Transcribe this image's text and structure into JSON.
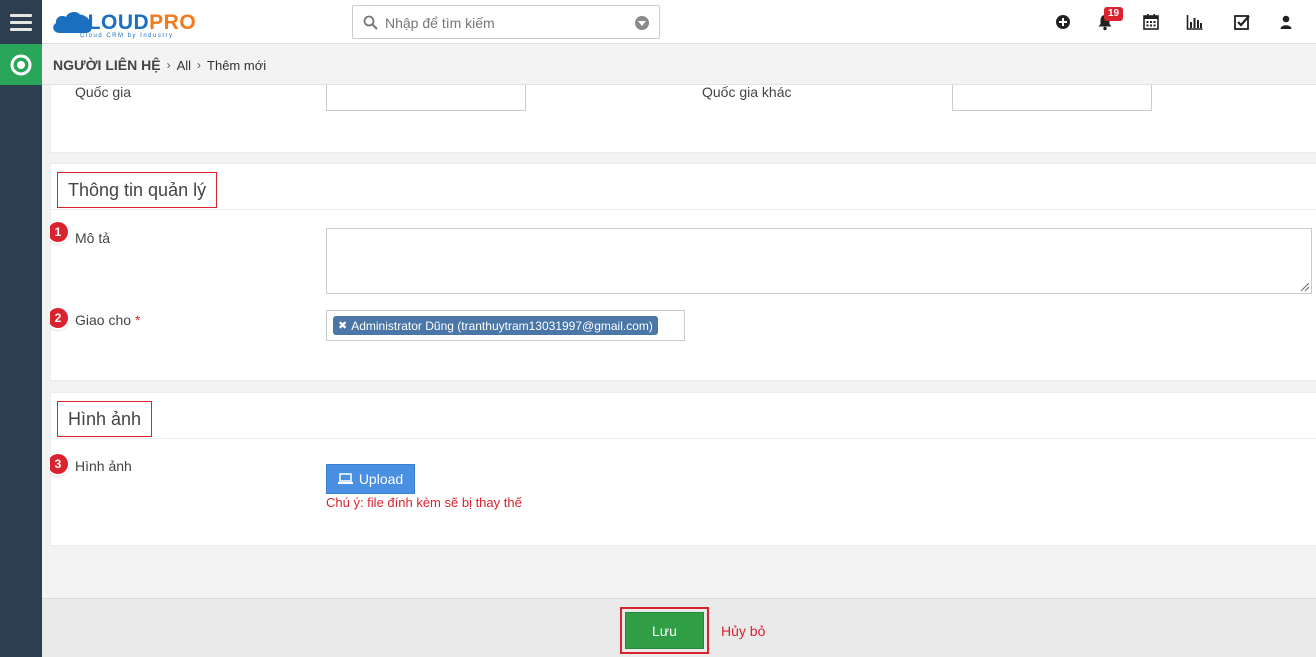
{
  "app": {
    "logo_main": "CLOUD",
    "logo_accent": "PRO",
    "logo_tagline": "Cloud CRM by Industry"
  },
  "search": {
    "placeholder": "Nhập để tìm kiếm"
  },
  "header": {
    "notification_count": "19"
  },
  "breadcrumb": {
    "module": "NGƯỜI LIÊN HỆ",
    "filter": "All",
    "action": "Thêm mới"
  },
  "address": {
    "country_label": "Quốc gia",
    "other_country_label": "Quốc gia khác"
  },
  "management": {
    "title": "Thông tin quản lý",
    "description_label": "Mô tả",
    "assigned_label": "Giao cho",
    "required_mark": "*",
    "assigned_value": "Administrator Dũng (tranthuytram13031997@gmail.com)",
    "steps": [
      "1",
      "2"
    ]
  },
  "image": {
    "title": "Hình ảnh",
    "field_label": "Hình ảnh",
    "upload_label": "Upload",
    "note": "Chú ý: file đính kèm sẽ bị thay thế",
    "step": "3"
  },
  "footer": {
    "save_label": "Lưu",
    "cancel_label": "Hủy bỏ"
  },
  "colors": {
    "accent_red": "#d9232e",
    "save_green": "#2f9e45",
    "upload_blue": "#4a90e2",
    "rail": "#2d3e50",
    "module_green": "#2aa65a"
  }
}
